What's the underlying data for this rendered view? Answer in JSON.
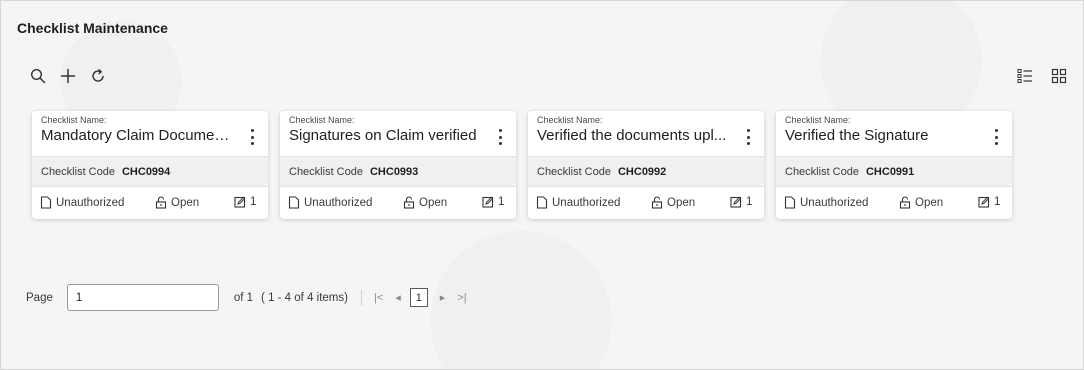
{
  "header": {
    "title": "Checklist Maintenance"
  },
  "toolbar": {
    "search_icon": "search-icon",
    "add_icon": "plus-icon",
    "refresh_icon": "refresh-icon"
  },
  "view_toggle": {
    "list_icon": "list-view-icon",
    "grid_icon": "grid-view-icon"
  },
  "cards": [
    {
      "name_label": "Checklist Name:",
      "name": "Mandatory Claim Documen...",
      "code_label": "Checklist Code",
      "code": "CHC0994",
      "status": "Unauthorized",
      "lock": "Open",
      "edit_count": "1"
    },
    {
      "name_label": "Checklist Name:",
      "name": "Signatures on Claim verified",
      "code_label": "Checklist Code",
      "code": "CHC0993",
      "status": "Unauthorized",
      "lock": "Open",
      "edit_count": "1"
    },
    {
      "name_label": "Checklist Name:",
      "name": "Verified the documents upl...",
      "code_label": "Checklist Code",
      "code": "CHC0992",
      "status": "Unauthorized",
      "lock": "Open",
      "edit_count": "1"
    },
    {
      "name_label": "Checklist Name:",
      "name": "Verified the Signature",
      "code_label": "Checklist Code",
      "code": "CHC0991",
      "status": "Unauthorized",
      "lock": "Open",
      "edit_count": "1"
    }
  ],
  "pagination": {
    "page_label": "Page",
    "page_value": "1",
    "of_text": "of 1",
    "items_text": "( 1 - 4 of 4 items)",
    "first": "|<",
    "prev": "◂",
    "current": "1",
    "next": "▸",
    "last": ">|"
  }
}
